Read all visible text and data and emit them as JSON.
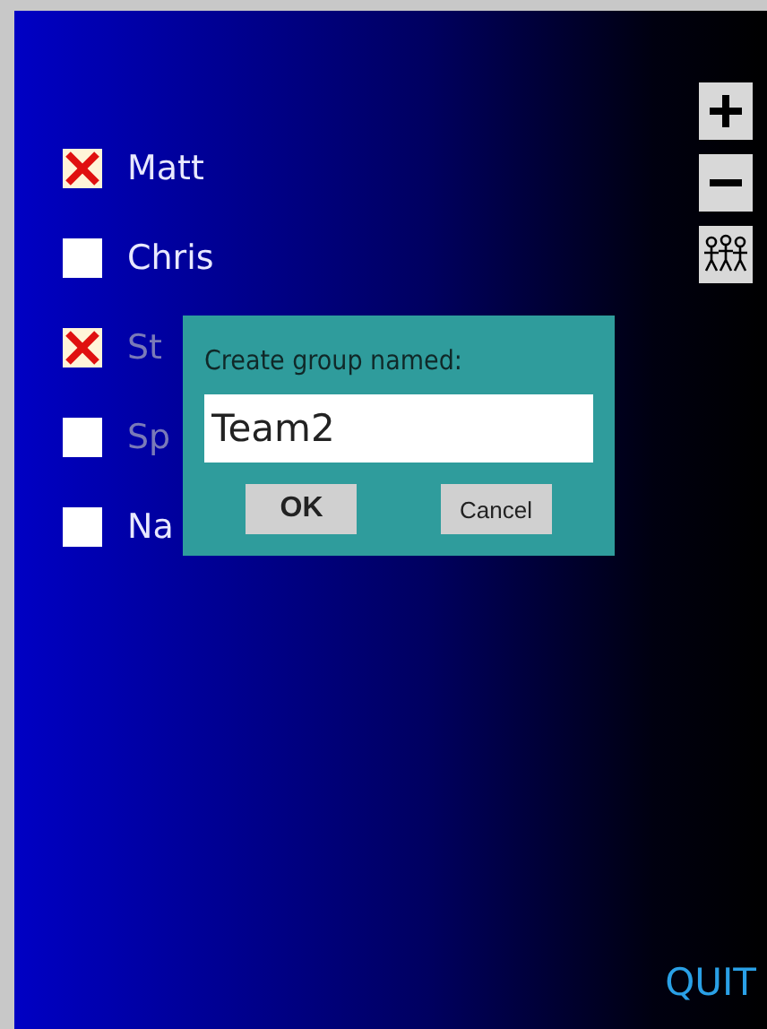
{
  "people": [
    {
      "name": "Matt",
      "checked": true,
      "dimmed": false
    },
    {
      "name": "Chris",
      "checked": false,
      "dimmed": false
    },
    {
      "name": "St",
      "checked": true,
      "dimmed": true
    },
    {
      "name": "Sp",
      "checked": false,
      "dimmed": true
    },
    {
      "name": "Na",
      "checked": false,
      "dimmed": false
    }
  ],
  "tools": [
    {
      "kind": "add"
    },
    {
      "kind": "remove"
    },
    {
      "kind": "group"
    }
  ],
  "dialog": {
    "title": "Create group named:",
    "value": "Team2",
    "buttons": [
      {
        "label": "OK",
        "primary": true
      },
      {
        "label": "Cancel",
        "primary": false
      }
    ]
  },
  "quit": "QUIT"
}
